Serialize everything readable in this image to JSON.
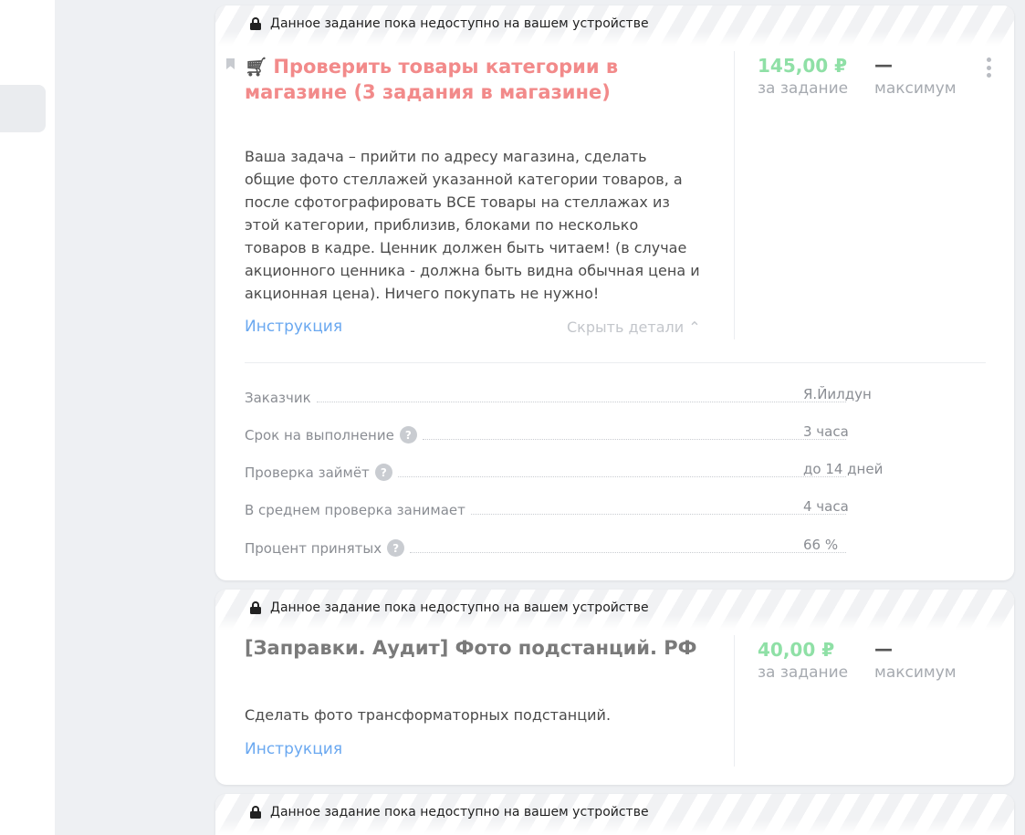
{
  "banner_text": "Данное задание пока недоступно на вашем устройстве",
  "tasks": [
    {
      "title": "Проверить товары категории в магазине (3 задания в магазине)",
      "price": "145,00 ₽",
      "price_sub": "за задание",
      "max": "—",
      "max_sub": "максимум",
      "description": "Ваша задача – прийти по адресу магазина, сделать общие фото стеллажей указанной категории товаров, а после сфотографировать ВСЕ товары на стеллажах из этой категории, приблизив, блоками по несколько товаров в кадре. Ценник должен быть читаем! (в случае акционного ценника - должна быть видна обычная цена и акционная цена). Ничего покупать не нужно!",
      "instruction": "Инструкция",
      "hide_details": "Скрыть детали ⌃",
      "meta": [
        {
          "label": "Заказчик",
          "value": "Я.Йилдун"
        },
        {
          "label": "Срок на выполнение",
          "value": "3 часа"
        },
        {
          "label": "Проверка займёт",
          "value": "до 14 дней"
        },
        {
          "label": "В среднем проверка занимает",
          "value": "4 часа"
        },
        {
          "label": "Процент принятых",
          "value": "66 %"
        }
      ]
    },
    {
      "title": "[Заправки. Аудит] Фото подстанций. РФ",
      "price": "40,00 ₽",
      "price_sub": "за задание",
      "max": "—",
      "max_sub": "максимум",
      "description": "Сделать фото трансформаторных подстанций.",
      "instruction": "Инструкция"
    }
  ],
  "icons": {
    "lock": "lock-icon",
    "bookmark": "bookmark-icon",
    "cart": "shopping-cart-icon",
    "more": "more-vertical-icon",
    "help": "question-icon"
  },
  "colors": {
    "title_active": "#f28a8a",
    "price": "#8fe0a6",
    "link": "#6aa8f0"
  }
}
